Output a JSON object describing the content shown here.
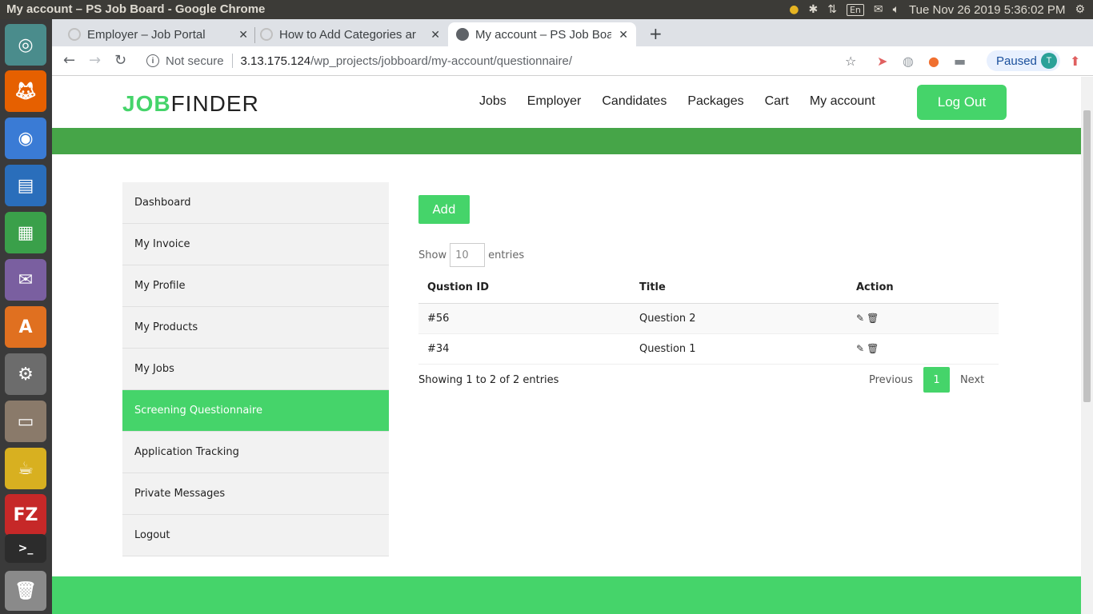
{
  "os": {
    "window_title": "My account – PS Job Board - Google Chrome",
    "keyboard_layout": "En",
    "clock": "Tue Nov 26 2019  5:36:02 PM"
  },
  "browser": {
    "tabs": [
      {
        "label": "Employer – Job Portal"
      },
      {
        "label": "How to Add Categories ar"
      },
      {
        "label": "My account – PS Job Boar"
      }
    ],
    "new_tab": "+",
    "security": "Not secure",
    "url_host": "3.13.175.124",
    "url_path": "/wp_projects/jobboard/my-account/questionnaire/",
    "profile_status": "Paused",
    "profile_initial": "T"
  },
  "site": {
    "logo_part1": "JOB",
    "logo_part2": "FINDER",
    "nav": [
      "Jobs",
      "Employer",
      "Candidates",
      "Packages",
      "Cart",
      "My account"
    ],
    "logout_button": "Log Out",
    "accent_color": "#45d46a",
    "band_color": "#46a548"
  },
  "sidebar": {
    "items": [
      {
        "label": "Dashboard"
      },
      {
        "label": "My Invoice"
      },
      {
        "label": "My Profile"
      },
      {
        "label": "My Products"
      },
      {
        "label": "My Jobs"
      },
      {
        "label": "Screening Questionnaire",
        "active": true
      },
      {
        "label": "Application Tracking"
      },
      {
        "label": "Private Messages"
      },
      {
        "label": "Logout"
      }
    ]
  },
  "main": {
    "add_button": "Add",
    "show_label": "Show",
    "entries_value": "10",
    "entries_label": "entries",
    "columns": [
      "Qustion ID",
      "Title",
      "Action"
    ],
    "rows": [
      {
        "id": "#56",
        "title": "Question 2"
      },
      {
        "id": "#34",
        "title": "Question 1"
      }
    ],
    "info": "Showing 1 to 2 of 2 entries",
    "pagination": {
      "previous": "Previous",
      "current": "1",
      "next": "Next"
    }
  }
}
